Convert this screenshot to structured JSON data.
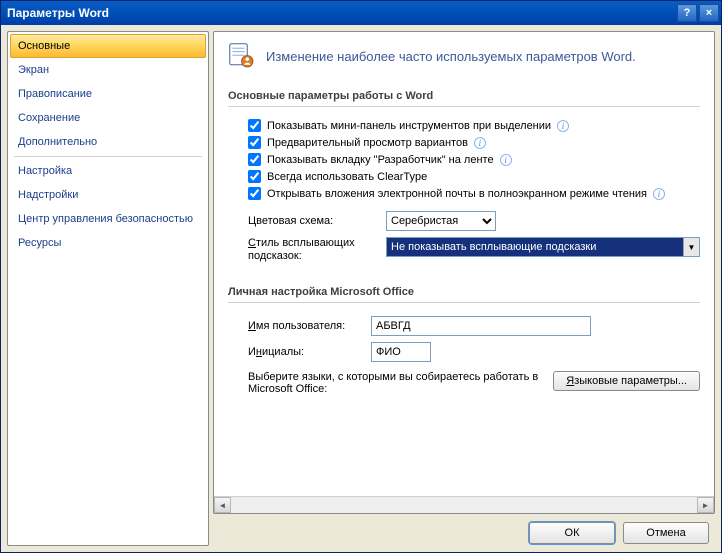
{
  "titlebar": {
    "title": "Параметры Word",
    "help_symbol": "?",
    "close_symbol": "×"
  },
  "sidebar": {
    "items": [
      {
        "label": "Основные",
        "selected": true
      },
      {
        "label": "Экран"
      },
      {
        "label": "Правописание"
      },
      {
        "label": "Сохранение"
      },
      {
        "label": "Дополнительно"
      },
      {
        "sep": true
      },
      {
        "label": "Настройка"
      },
      {
        "label": "Надстройки"
      },
      {
        "label": "Центр управления безопасностью"
      },
      {
        "label": "Ресурсы"
      }
    ]
  },
  "main": {
    "header": "Изменение наиболее часто используемых параметров Word.",
    "section1_title": "Основные параметры работы с Word",
    "checks": [
      {
        "label_pre": "П",
        "label": "оказывать мини-панель инструментов при выделении",
        "info": true,
        "checked": true
      },
      {
        "label_pre": "",
        "label": "Предварительный просмотр вариантов",
        "info": true,
        "checked": true,
        "u_index": 20
      },
      {
        "label_pre": "",
        "label": "Показывать вкладку \"Разработчик\" на ленте",
        "info": true,
        "checked": true,
        "u_index": 20
      },
      {
        "label_pre": "Вс",
        "label": "егда использовать ClearType",
        "info": false,
        "checked": true,
        "u_index": 2
      },
      {
        "label_pre": "",
        "label": "Открывать вложения электронной почты в полноэкранном режиме чтения",
        "info": true,
        "checked": true,
        "u_index": 10
      }
    ],
    "color_scheme_label": "Цветовая схема:",
    "color_scheme_value": "Серебристая",
    "tooltip_style_label": "Стиль всплывающих подсказок:",
    "tooltip_style_value": "Не показывать всплывающие подсказки",
    "section2_title": "Личная настройка Microsoft Office",
    "username_label": "Имя пользователя:",
    "username_value": "АБВГД",
    "initials_label": "Инициалы:",
    "initials_value": "ФИО",
    "lang_text": "Выберите языки, с которыми вы собираетесь работать в Microsoft Office:",
    "lang_button": "Языковые параметры..."
  },
  "footer": {
    "ok": "ОК",
    "cancel": "Отмена"
  }
}
